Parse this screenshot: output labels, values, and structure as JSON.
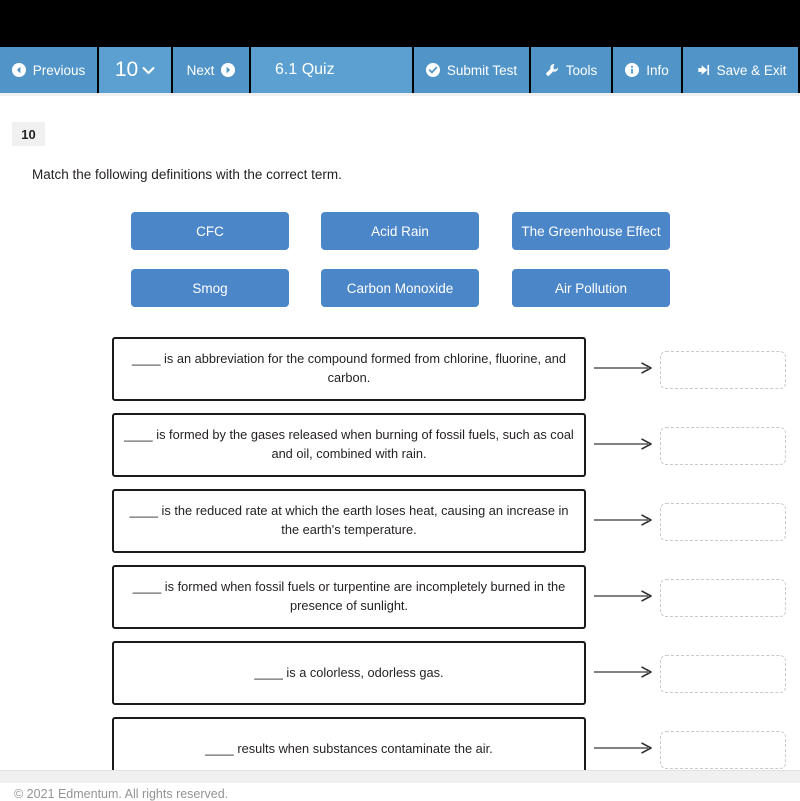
{
  "toolbar": {
    "previous_label": "Previous",
    "previous_icon": "arrow-left-circle-icon",
    "question_number": "10",
    "question_dropdown_icon": "chevron-down-icon",
    "next_label": "Next",
    "next_icon": "arrow-right-circle-icon",
    "quiz_title": "6.1 Quiz",
    "submit_label": "Submit Test",
    "submit_icon": "check-circle-icon",
    "tools_label": "Tools",
    "tools_icon": "wrench-icon",
    "info_label": "Info",
    "info_icon": "info-circle-icon",
    "save_exit_label": "Save & Exit",
    "save_exit_icon": "sign-out-icon",
    "accent_color": "#5195c8",
    "band_color": "#000000"
  },
  "question": {
    "number_badge": "10",
    "prompt": "Match the following definitions with the correct term."
  },
  "terms": [
    {
      "label": "CFC"
    },
    {
      "label": "Acid Rain"
    },
    {
      "label": "The Greenhouse Effect"
    },
    {
      "label": "Smog"
    },
    {
      "label": "Carbon Monoxide"
    },
    {
      "label": "Air Pollution"
    }
  ],
  "term_tile_color": "#4a86c8",
  "definitions": [
    {
      "text": "____ is an abbreviation for the compound formed from chlorine, fluorine, and carbon.",
      "answer": ""
    },
    {
      "text": "____ is formed by the gases released when burning of fossil fuels, such as coal and oil, combined with rain.",
      "answer": ""
    },
    {
      "text": "____ is the reduced rate at which the earth loses heat, causing an increase in the earth's temperature.",
      "answer": ""
    },
    {
      "text": "____ is formed when fossil fuels or turpentine are incompletely burned in the presence of sunlight.",
      "answer": ""
    },
    {
      "text": "____ is a colorless, odorless gas.",
      "answer": ""
    },
    {
      "text": "____ results when substances contaminate the air.",
      "answer": ""
    }
  ],
  "footer": {
    "copyright": "© 2021 Edmentum. All rights reserved."
  }
}
